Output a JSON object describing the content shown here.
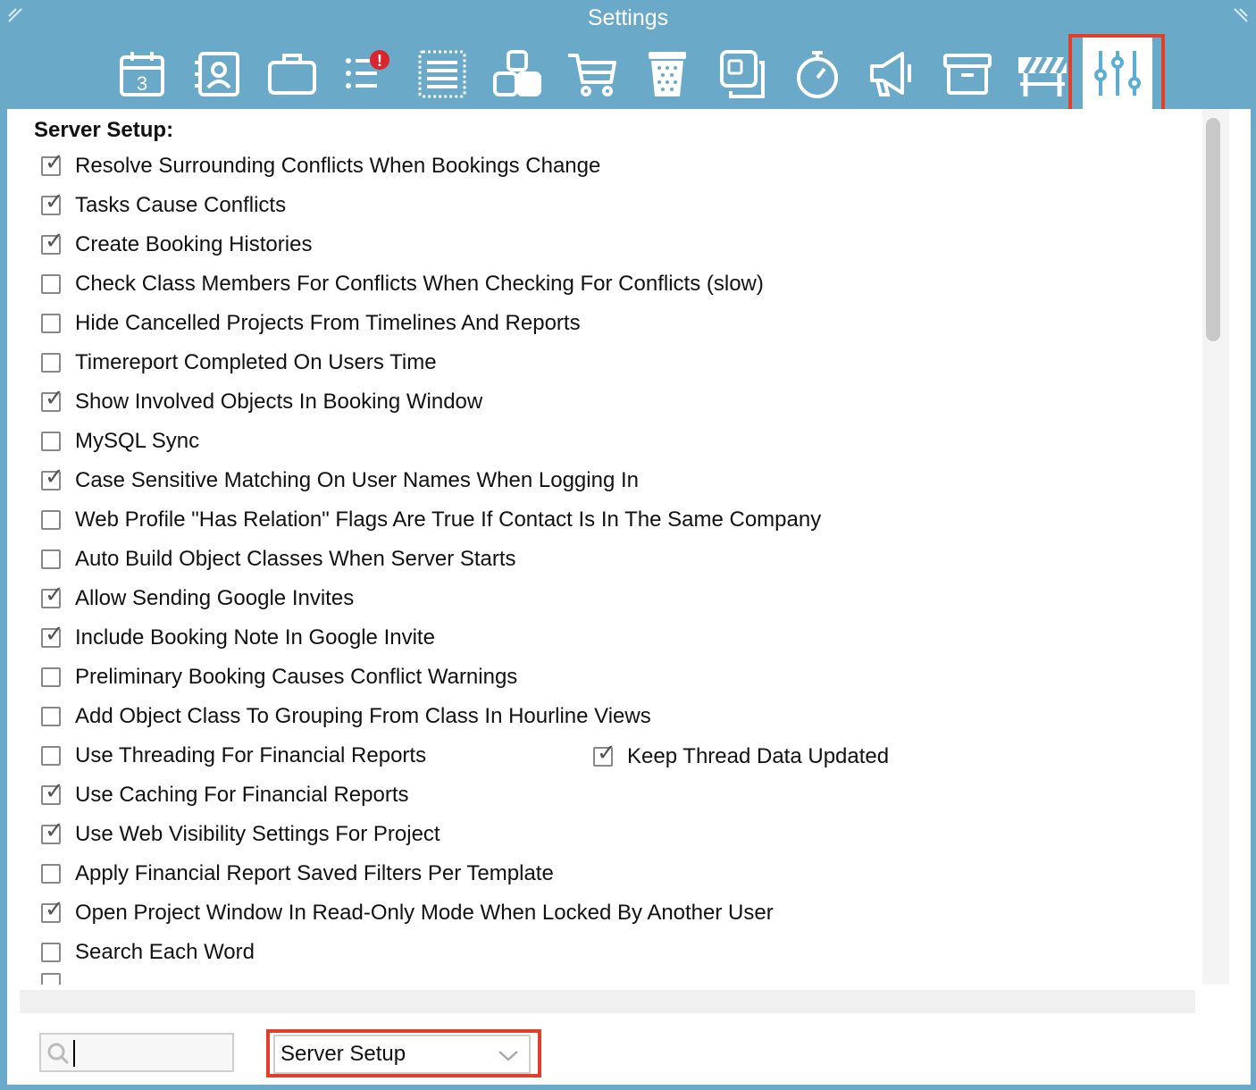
{
  "window": {
    "title": "Settings"
  },
  "toolbar": {
    "icons": [
      {
        "name": "calendar-icon",
        "day": "3"
      },
      {
        "name": "contacts-icon"
      },
      {
        "name": "briefcase-icon"
      },
      {
        "name": "task-list-alert-icon",
        "alert": "!"
      },
      {
        "name": "list-box-icon"
      },
      {
        "name": "objects-icon"
      },
      {
        "name": "cart-icon"
      },
      {
        "name": "trash-icon"
      },
      {
        "name": "layers-icon"
      },
      {
        "name": "timer-icon"
      },
      {
        "name": "megaphone-icon"
      },
      {
        "name": "archive-icon"
      },
      {
        "name": "barrier-icon"
      },
      {
        "name": "sliders-icon",
        "selected": true
      }
    ],
    "accent_color": "#6aa9c8",
    "highlight_color": "#e0402a"
  },
  "section": {
    "title": "Server Setup:"
  },
  "options": [
    {
      "label": "Resolve Surrounding Conflicts When Bookings Change",
      "checked": true
    },
    {
      "label": "Tasks Cause Conflicts",
      "checked": true
    },
    {
      "label": "Create Booking Histories",
      "checked": true
    },
    {
      "label": "Check Class Members For Conflicts When Checking For Conflicts (slow)",
      "checked": false
    },
    {
      "label": "Hide Cancelled Projects From Timelines And Reports",
      "checked": false
    },
    {
      "label": "Timereport Completed On Users Time",
      "checked": false
    },
    {
      "label": "Show Involved Objects In Booking Window",
      "checked": true
    },
    {
      "label": "MySQL Sync",
      "checked": false
    },
    {
      "label": "Case Sensitive Matching On User Names When Logging In",
      "checked": true
    },
    {
      "label": "Web Profile \"Has Relation\" Flags Are True If Contact Is In The Same Company",
      "checked": false
    },
    {
      "label": "Auto Build Object Classes When Server Starts",
      "checked": false
    },
    {
      "label": "Allow Sending Google Invites",
      "checked": true
    },
    {
      "label": "Include Booking Note In Google Invite",
      "checked": true
    },
    {
      "label": "Preliminary Booking Causes Conflict Warnings",
      "checked": false
    },
    {
      "label": "Add Object Class To Grouping From Class In Hourline Views",
      "checked": false
    },
    {
      "label": "Use Threading For Financial Reports",
      "checked": false
    },
    {
      "label": "Use Caching For Financial Reports",
      "checked": true
    },
    {
      "label": "Use Web Visibility Settings For Project",
      "checked": true
    },
    {
      "label": "Apply Financial Report Saved Filters Per Template",
      "checked": false
    },
    {
      "label": "Open Project Window In Read-Only Mode When Locked By Another User",
      "checked": true
    },
    {
      "label": "Search Each Word",
      "checked": false
    }
  ],
  "side_option": {
    "label": "Keep Thread Data Updated",
    "checked": true
  },
  "footer": {
    "search_value": "",
    "dropdown_value": "Server Setup"
  }
}
